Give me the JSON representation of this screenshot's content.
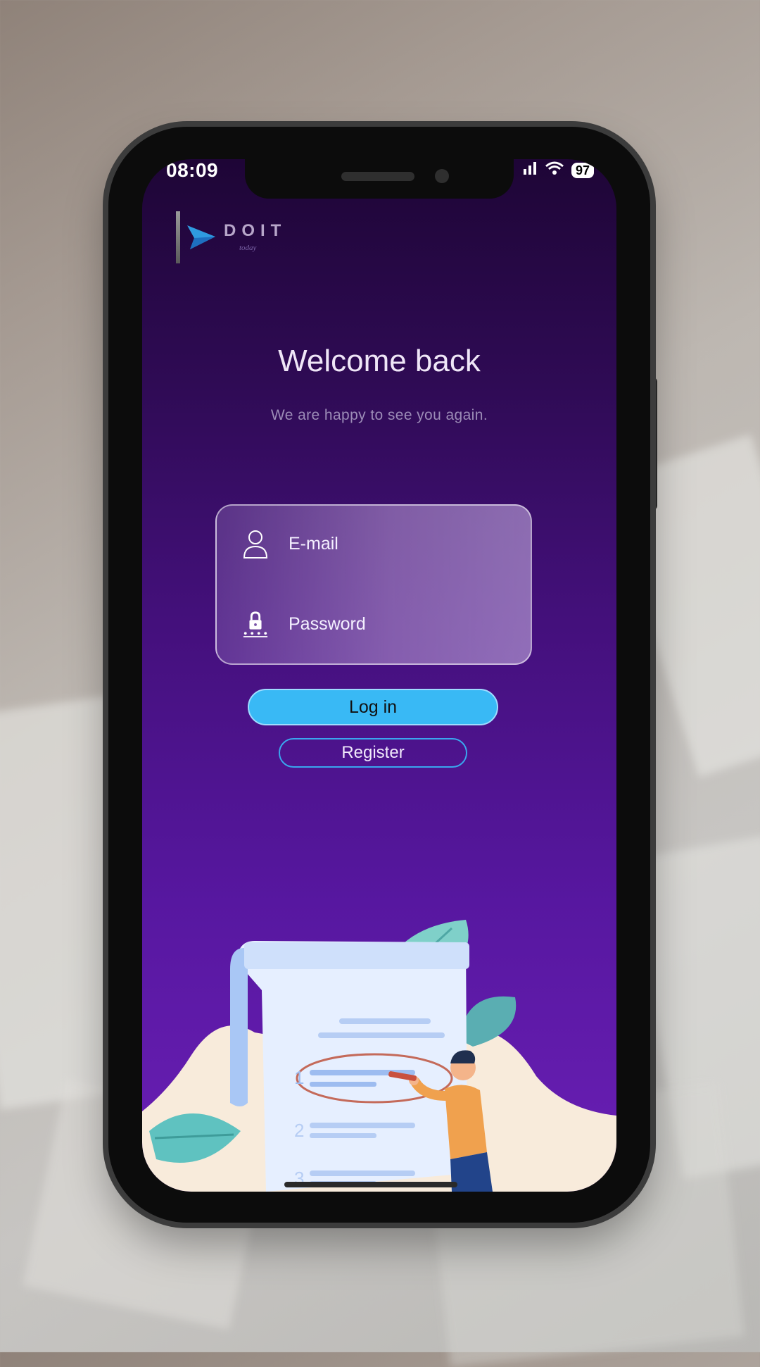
{
  "status_bar": {
    "time": "08:09",
    "battery": "97"
  },
  "logo": {
    "name": "DOIT",
    "tagline": "today"
  },
  "welcome": {
    "title": "Welcome back",
    "subtitle": "We are happy to see you again."
  },
  "login_form": {
    "email_placeholder": "E-mail",
    "password_placeholder": "Password"
  },
  "buttons": {
    "login": "Log in",
    "register": "Register"
  },
  "illustration": {
    "list_numbers": [
      "1",
      "2",
      "3"
    ]
  },
  "colors": {
    "accent": "#39b9f5",
    "background_top": "#1e0536",
    "background_bottom": "#6a1fb5"
  }
}
